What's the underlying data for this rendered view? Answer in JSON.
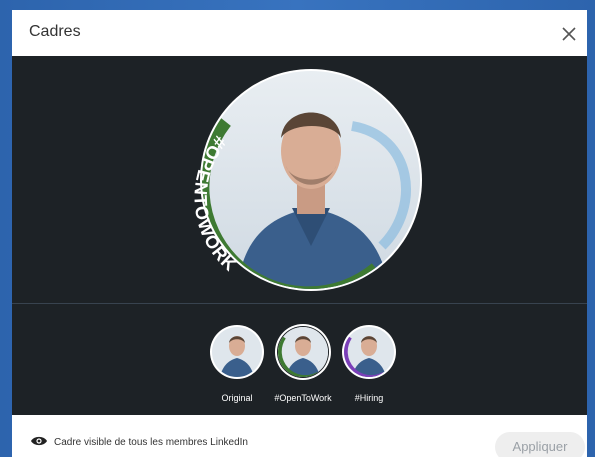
{
  "dialog": {
    "title": "Cadres",
    "close_icon": "close-icon"
  },
  "preview": {
    "frame_text": "#OPENTOWORK",
    "frame_color": "#3e7a32"
  },
  "frames": [
    {
      "label": "Original",
      "ring_color": "#ffffff",
      "selected": false
    },
    {
      "label": "#OpenToWork",
      "ring_color": "#3e7a32",
      "selected": true
    },
    {
      "label": "#Hiring",
      "ring_color": "#7b3fb8",
      "selected": false
    }
  ],
  "footer": {
    "eye_icon": "eye-icon",
    "visibility_text": "Cadre visible de tous les membres LinkedIn",
    "apply_label": "Appliquer"
  },
  "colors": {
    "stage_bg": "#1d2226",
    "open_to_work_green": "#3e7a32",
    "hiring_purple": "#7b3fb8"
  }
}
